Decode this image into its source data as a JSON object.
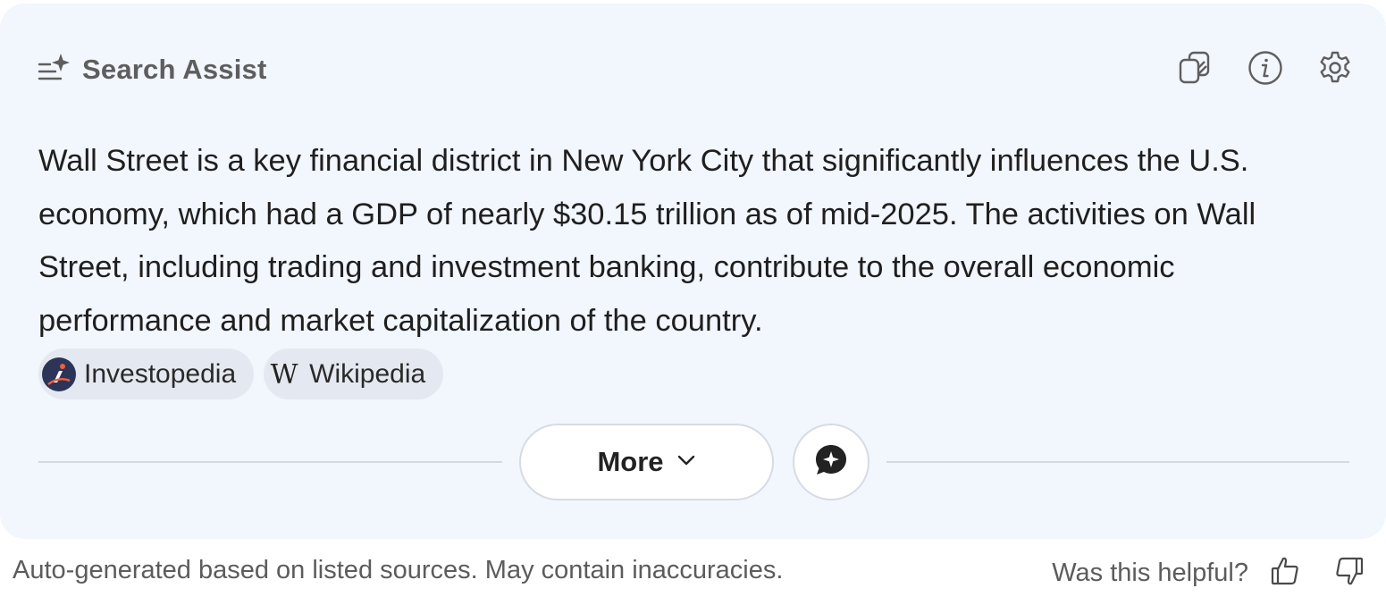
{
  "header": {
    "title": "Search Assist",
    "icon": "sparkle-list-icon"
  },
  "toolbar": {
    "icons": [
      "copy-icon",
      "info-icon",
      "settings-gear-icon"
    ]
  },
  "answer": {
    "text": "Wall Street is a key financial district in New York City that significantly influences the U.S. economy, which had a GDP of nearly $30.15 trillion as of mid-2025. The activities on Wall Street, including trading and investment banking, contribute to the overall economic performance and market capitalization of the country."
  },
  "sources": [
    {
      "label": "Investopedia",
      "icon": "investopedia-logo-icon"
    },
    {
      "label": "Wikipedia",
      "icon": "wikipedia-logo-icon"
    }
  ],
  "actions": {
    "more_label": "More",
    "more_icon": "chevron-down-icon",
    "chat_icon": "chat-sparkle-icon"
  },
  "footer": {
    "note": "Auto-generated based on listed sources. May contain inaccuracies.",
    "helpful_label": "Was this helpful?"
  },
  "colors": {
    "card_background": "#f2f6fd",
    "text": "#1f1f1f",
    "muted": "#5c5c5c"
  }
}
